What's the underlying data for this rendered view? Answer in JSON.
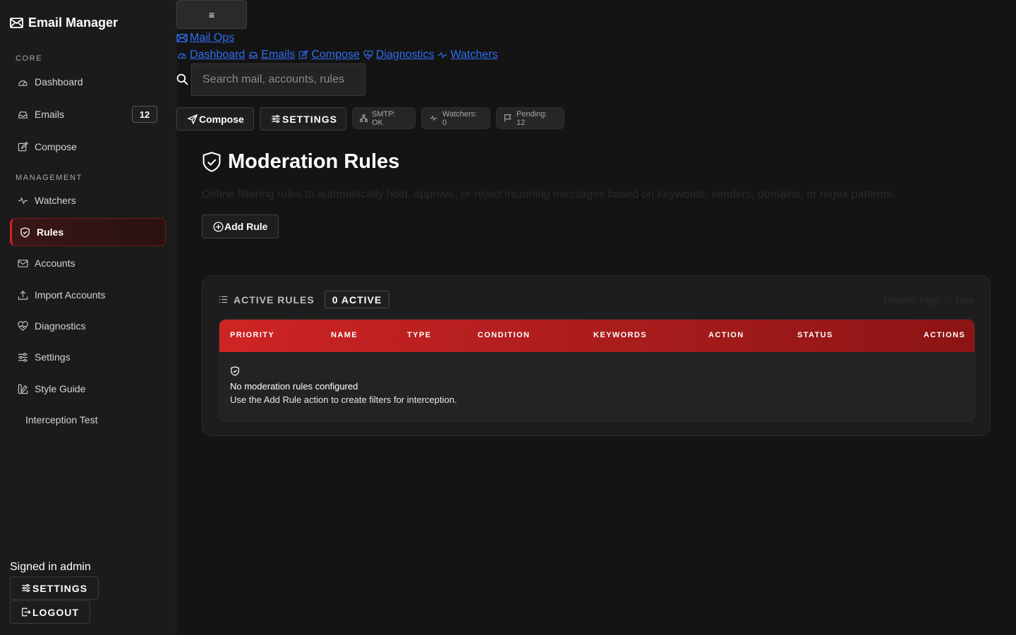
{
  "app": {
    "title": "Email Manager"
  },
  "sidebar": {
    "sections": {
      "core": "CORE",
      "management": "MANAGEMENT"
    },
    "items": [
      {
        "label": "Dashboard",
        "icon": "gauge-icon"
      },
      {
        "label": "Emails",
        "icon": "inbox-icon",
        "badge": "12"
      },
      {
        "label": "Compose",
        "icon": "pencil-square-icon"
      },
      {
        "label": "Watchers",
        "icon": "activity-icon"
      },
      {
        "label": "Rules",
        "icon": "shield-check-icon",
        "active": true
      },
      {
        "label": "Accounts",
        "icon": "envelope-paper-icon"
      },
      {
        "label": "Import Accounts",
        "icon": "upload-icon"
      },
      {
        "label": "Diagnostics",
        "icon": "heart-pulse-icon"
      },
      {
        "label": "Settings",
        "icon": "sliders-icon"
      },
      {
        "label": "Style Guide",
        "icon": "palette-icon"
      },
      {
        "label": "Interception Test"
      }
    ],
    "footer": {
      "signed_in": "Signed in admin",
      "settings": "SETTINGS",
      "logout": "LOGOUT"
    }
  },
  "topbar": {
    "menu_icon": "≡",
    "brand_link": "Mail Ops",
    "links": [
      "Dashboard",
      "Emails",
      "Compose",
      "Diagnostics",
      "Watchers"
    ],
    "search_placeholder": "Search mail, accounts, rules",
    "compose": "Compose",
    "settings": "SETTINGS",
    "status": {
      "smtp": "SMTP: OK",
      "watchers": "Watchers: 0",
      "pending": "Pending: 12"
    }
  },
  "main": {
    "title": "Moderation Rules",
    "subtitle": "Define filtering rules to automatically hold, approve, or reject incoming messages based on keywords, senders, domains, or regex patterns.",
    "add_rule": "Add Rule",
    "card": {
      "title": "ACTIVE RULES",
      "active_count": "0 ACTIVE",
      "sort_label": "Priority: High → Low",
      "columns": [
        "PRIORITY",
        "NAME",
        "TYPE",
        "CONDITION",
        "KEYWORDS",
        "ACTION",
        "STATUS",
        "ACTIONS"
      ],
      "empty_title": "No moderation rules configured",
      "empty_hint": "Use the Add Rule action to create filters for interception."
    }
  },
  "colors": {
    "accent": "#c62828",
    "link": "#2f6df2",
    "background": "#141414"
  }
}
